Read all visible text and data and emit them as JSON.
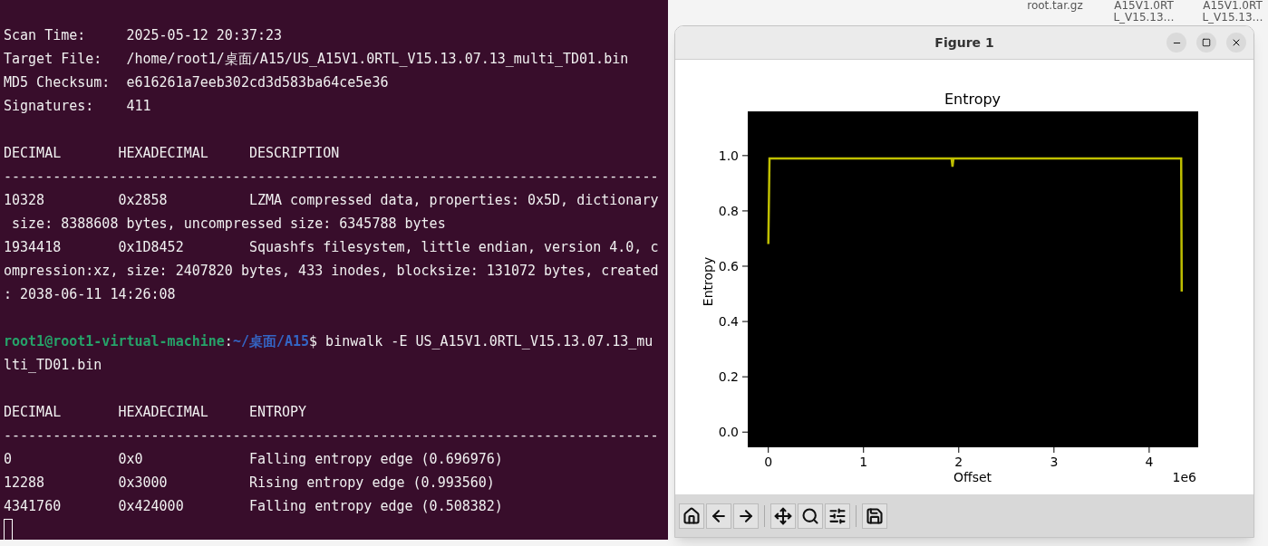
{
  "desktop_icons": [
    {
      "label_lines": [
        "root.tar.gz"
      ]
    },
    {
      "label_lines": [
        "A15V1.0RT",
        "L_V15.13…"
      ]
    },
    {
      "label_lines": [
        "A15V1.0RT",
        "L_V15.13…"
      ]
    }
  ],
  "terminal": {
    "lines": [
      {
        "kind": "blank"
      },
      {
        "kind": "text",
        "text": "Scan Time:     2025-05-12 20:37:23"
      },
      {
        "kind": "text",
        "text": "Target File:   /home/root1/桌面/A15/US_A15V1.0RTL_V15.13.07.13_multi_TD01.bin"
      },
      {
        "kind": "text",
        "text": "MD5 Checksum:  e616261a7eeb302cd3d583ba64ce5e36"
      },
      {
        "kind": "text",
        "text": "Signatures:    411"
      },
      {
        "kind": "blank"
      },
      {
        "kind": "text",
        "text": "DECIMAL       HEXADECIMAL     DESCRIPTION"
      },
      {
        "kind": "text",
        "text": "--------------------------------------------------------------------------------"
      },
      {
        "kind": "text",
        "text": "10328         0x2858          LZMA compressed data, properties: 0x5D, dictionary"
      },
      {
        "kind": "text",
        "text": " size: 8388608 bytes, uncompressed size: 6345788 bytes"
      },
      {
        "kind": "text",
        "text": "1934418       0x1D8452        Squashfs filesystem, little endian, version 4.0, c"
      },
      {
        "kind": "text",
        "text": "ompression:xz, size: 2407820 bytes, 433 inodes, blocksize: 131072 bytes, created"
      },
      {
        "kind": "text",
        "text": ": 2038-06-11 14:26:08"
      },
      {
        "kind": "blank"
      },
      {
        "kind": "prompt",
        "user_host": "root1@root1-virtual-machine",
        "separator": ":",
        "path": "~/桌面/A15",
        "command": "$ binwalk -E US_A15V1.0RTL_V15.13.07.13_mu"
      },
      {
        "kind": "text",
        "text": "lti_TD01.bin"
      },
      {
        "kind": "blank"
      },
      {
        "kind": "text",
        "text": "DECIMAL       HEXADECIMAL     ENTROPY"
      },
      {
        "kind": "text",
        "text": "--------------------------------------------------------------------------------"
      },
      {
        "kind": "text",
        "text": "0             0x0             Falling entropy edge (0.696976)"
      },
      {
        "kind": "text",
        "text": "12288         0x3000          Rising entropy edge (0.993560)"
      },
      {
        "kind": "text",
        "text": "4341760       0x424000        Falling entropy edge (0.508382)"
      },
      {
        "kind": "cursor"
      }
    ]
  },
  "figure_window": {
    "title": "Figure 1",
    "chart_data": {
      "type": "line",
      "title": "Entropy",
      "xlabel": "Offset",
      "ylabel": "Entropy",
      "x": [
        0,
        0.012288,
        1.925,
        1.934418,
        1.945,
        4.336,
        4.34176
      ],
      "values": [
        0.68,
        0.99,
        0.99,
        0.96,
        0.99,
        0.99,
        0.508
      ],
      "xlim": [
        -0.216,
        4.515
      ],
      "ylim": [
        -0.055,
        1.16
      ],
      "xticks": [
        0,
        1,
        2,
        3,
        4
      ],
      "yticks": [
        {
          "value": 0,
          "label": "0.0"
        },
        {
          "value": 0.2,
          "label": "0.2"
        },
        {
          "value": 0.4,
          "label": "0.4"
        },
        {
          "value": 0.6,
          "label": "0.6"
        },
        {
          "value": 0.8,
          "label": "0.8"
        },
        {
          "value": 1,
          "label": "1.0"
        }
      ]
    },
    "axis_offset_label": "1e6"
  }
}
